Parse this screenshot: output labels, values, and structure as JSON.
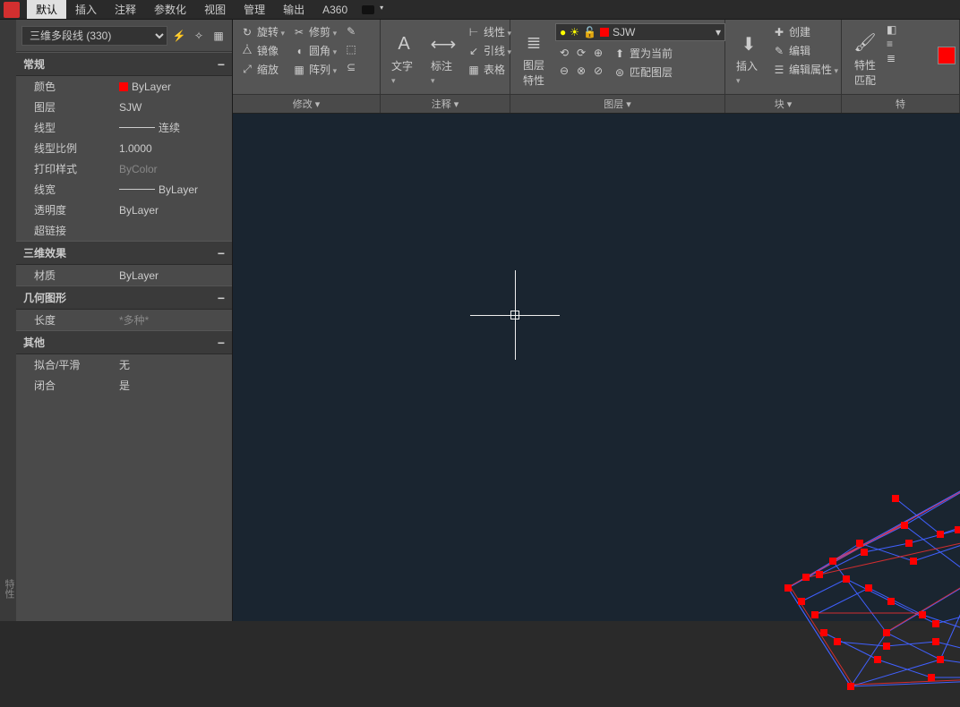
{
  "menu": {
    "items": [
      "默认",
      "插入",
      "注释",
      "参数化",
      "视图",
      "管理",
      "输出",
      "A360"
    ],
    "active": 0
  },
  "selection": {
    "label": "三维多段线 (330)"
  },
  "sidetab": "特性",
  "sections": {
    "general": {
      "title": "常规",
      "rows": [
        {
          "k": "颜色",
          "v": "ByLayer",
          "swatch": true
        },
        {
          "k": "图层",
          "v": "SJW"
        },
        {
          "k": "线型",
          "v": "连续",
          "line": true
        },
        {
          "k": "线型比例",
          "v": "1.0000"
        },
        {
          "k": "打印样式",
          "v": "ByColor",
          "dim": true
        },
        {
          "k": "线宽",
          "v": "ByLayer",
          "line": true
        },
        {
          "k": "透明度",
          "v": "ByLayer"
        },
        {
          "k": "超链接",
          "v": ""
        }
      ]
    },
    "three_d": {
      "title": "三维效果",
      "rows": [
        {
          "k": "材质",
          "v": "ByLayer"
        }
      ]
    },
    "geom": {
      "title": "几何图形",
      "rows": [
        {
          "k": "长度",
          "v": "*多种*",
          "dim": true
        }
      ]
    },
    "other": {
      "title": "其他",
      "rows": [
        {
          "k": "拟合/平滑",
          "v": "无"
        },
        {
          "k": "闭合",
          "v": "是"
        }
      ]
    }
  },
  "ribbon": {
    "modify": {
      "title": "修改 ▾",
      "rotate": "旋转",
      "trim": "修剪",
      "mirror": "镜像",
      "fillet": "圆角",
      "scale": "缩放",
      "array": "阵列"
    },
    "annot": {
      "title": "注释 ▾",
      "text": "文字",
      "dim": "标注",
      "linear": "线性",
      "leader": "引线",
      "table": "表格"
    },
    "layer": {
      "title": "图层 ▾",
      "props": "图层\n特性",
      "current": "SJW",
      "setcur": "置为当前",
      "match": "匹配图层"
    },
    "block": {
      "title": "块 ▾",
      "insert": "插入",
      "create": "创建",
      "edit": "编辑",
      "editattr": "编辑属性"
    },
    "props": {
      "title": "特",
      "match": "特性\n匹配"
    }
  }
}
